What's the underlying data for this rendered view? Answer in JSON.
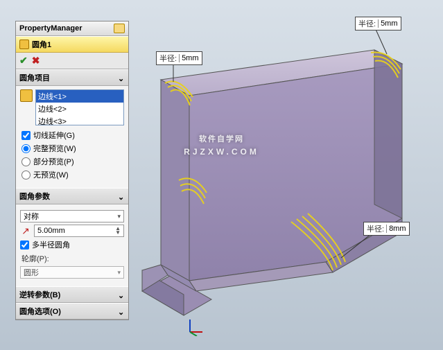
{
  "pm": {
    "title": "PropertyManager"
  },
  "feature": {
    "name": "圆角1"
  },
  "sections": {
    "items": {
      "title": "圆角项目"
    },
    "params": {
      "title": "圆角参数"
    },
    "reverse": {
      "title": "逆转参数(B)"
    },
    "options": {
      "title": "圆角选项(O)"
    }
  },
  "edges": {
    "list": [
      "边线<1>",
      "边线<2>",
      "边线<3>"
    ],
    "selected_index": 0
  },
  "item_opts": {
    "tangent": "切线延伸(G)",
    "full": "完整预览(W)",
    "partial": "部分预览(P)",
    "none": "无预览(W)",
    "tangent_checked": true,
    "preview_selected": "full"
  },
  "params": {
    "symmetry_label": "对称",
    "radius_value": "5.00mm",
    "multi_radius": "多半径圆角",
    "multi_checked": true,
    "profile_label": "轮廓(P):",
    "profile_value": "圆形"
  },
  "callouts": {
    "c1": {
      "label": "半径:",
      "value": "5mm"
    },
    "c2": {
      "label": "半径:",
      "value": "5mm"
    },
    "c3": {
      "label": "半径:",
      "value": "8mm"
    }
  },
  "watermark": {
    "main": "软件自学网",
    "sub": "RJZXW.COM"
  },
  "chevron": "⌄",
  "chevron_right": "›"
}
